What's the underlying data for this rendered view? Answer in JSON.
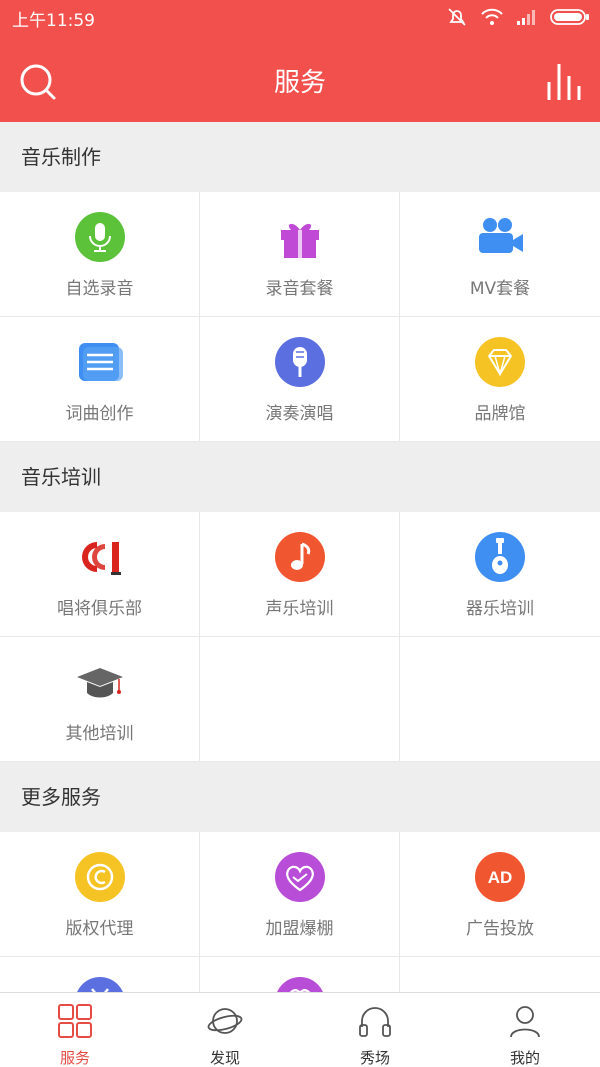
{
  "status": {
    "time": "上午11:59"
  },
  "header": {
    "title": "服务"
  },
  "sections": [
    {
      "title": "音乐制作",
      "items": [
        "自选录音",
        "录音套餐",
        "MV套餐",
        "词曲创作",
        "演奏演唱",
        "品牌馆"
      ]
    },
    {
      "title": "音乐培训",
      "items": [
        "唱将俱乐部",
        "声乐培训",
        "器乐培训",
        "其他培训"
      ]
    },
    {
      "title": "更多服务",
      "items": [
        "版权代理",
        "加盟爆棚",
        "广告投放"
      ]
    }
  ],
  "badges": {
    "ad": "AD"
  },
  "tabs": [
    {
      "label": "服务",
      "icon": "grid-icon",
      "active": true
    },
    {
      "label": "发现",
      "icon": "planet-icon",
      "active": false
    },
    {
      "label": "秀场",
      "icon": "headphones-icon",
      "active": false
    },
    {
      "label": "我的",
      "icon": "person-icon",
      "active": false
    }
  ],
  "colors": {
    "accent": "#f2504d",
    "active_tab": "#e54c43"
  }
}
